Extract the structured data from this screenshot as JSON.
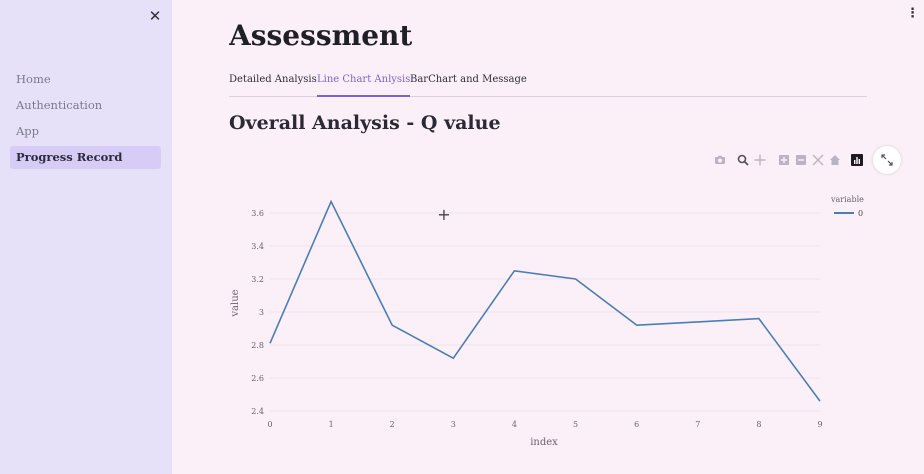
{
  "sidebar": {
    "close_icon": "close-icon",
    "items": [
      {
        "label": "Home",
        "active": false
      },
      {
        "label": "Authentication",
        "active": false
      },
      {
        "label": "App",
        "active": false
      },
      {
        "label": "Progress Record",
        "active": true
      }
    ]
  },
  "menu_icon": "kebab-menu-icon",
  "main": {
    "heading": "Assessment",
    "tabs": [
      {
        "label": "Detailed Analysis",
        "active": false
      },
      {
        "label": "Line Chart Anlysis",
        "active": true
      },
      {
        "label": "BarChart and Message",
        "active": false
      }
    ],
    "section_title": "Overall Analysis - Q value"
  },
  "modebar": {
    "icons": [
      "camera-icon",
      "zoom-icon",
      "pan-icon",
      "zoom-in-icon",
      "zoom-out-icon",
      "autoscale-icon",
      "home-icon",
      "plotly-logo-icon"
    ],
    "expand_icon": "expand-icon"
  },
  "colors": {
    "accent": "#7c63d4",
    "line": "#4a7fb5",
    "sidebar_bg": "#e6e1f8",
    "page_bg": "#fbeff8"
  },
  "chart_data": {
    "type": "line",
    "xlabel": "index",
    "ylabel": "value",
    "x": [
      0,
      1,
      2,
      3,
      4,
      5,
      6,
      7,
      8,
      9
    ],
    "xticks": [
      "0",
      "1",
      "2",
      "3",
      "4",
      "5",
      "6",
      "7",
      "8",
      "9"
    ],
    "yticks": [
      "2.4",
      "2.6",
      "2.8",
      "3",
      "3.2",
      "3.4",
      "3.6"
    ],
    "ytick_values": [
      2.4,
      2.6,
      2.8,
      3.0,
      3.2,
      3.4,
      3.6
    ],
    "xlim": [
      0,
      9
    ],
    "ylim": [
      2.4,
      3.6
    ],
    "grid": true,
    "legend": {
      "title": "variable",
      "placement": "top-right"
    },
    "series": [
      {
        "name": "0",
        "values": [
          2.81,
          3.67,
          2.92,
          2.72,
          3.25,
          3.2,
          2.92,
          2.94,
          2.96,
          2.46
        ]
      }
    ]
  }
}
